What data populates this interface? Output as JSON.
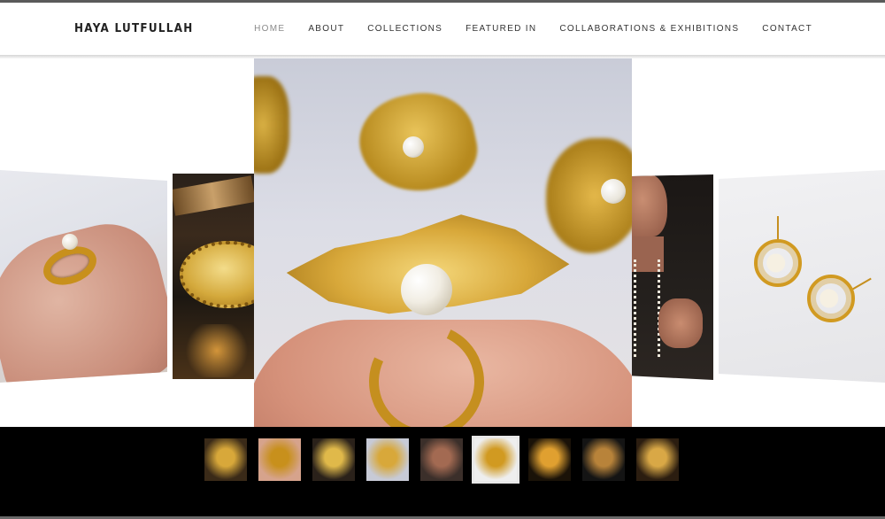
{
  "site": {
    "brand": "HAYA LUTFULLAH"
  },
  "nav": {
    "items": [
      {
        "label": "HOME",
        "active": true
      },
      {
        "label": "ABOUT",
        "active": false
      },
      {
        "label": "COLLECTIONS",
        "active": false
      },
      {
        "label": "FEATURED IN",
        "active": false
      },
      {
        "label": "COLLABORATIONS & EXHIBITIONS",
        "active": false
      },
      {
        "label": "CONTACT",
        "active": false
      }
    ]
  },
  "gallery": {
    "selected_index": 5,
    "thumbnails": [
      {
        "colors": [
          "#3a2a18",
          "#d8a83a"
        ]
      },
      {
        "colors": [
          "#d6a38c",
          "#c8901c"
        ]
      },
      {
        "colors": [
          "#2a211a",
          "#e0b94a"
        ]
      },
      {
        "colors": [
          "#c7cad6",
          "#d8a83a"
        ]
      },
      {
        "colors": [
          "#3b2f2a",
          "#a36a52"
        ]
      },
      {
        "colors": [
          "#eeeeee",
          "#d19a21"
        ]
      },
      {
        "colors": [
          "#1a1208",
          "#e0a030"
        ]
      },
      {
        "colors": [
          "#141414",
          "#b8833a"
        ]
      },
      {
        "colors": [
          "#2b1d10",
          "#d9a846"
        ]
      }
    ]
  }
}
